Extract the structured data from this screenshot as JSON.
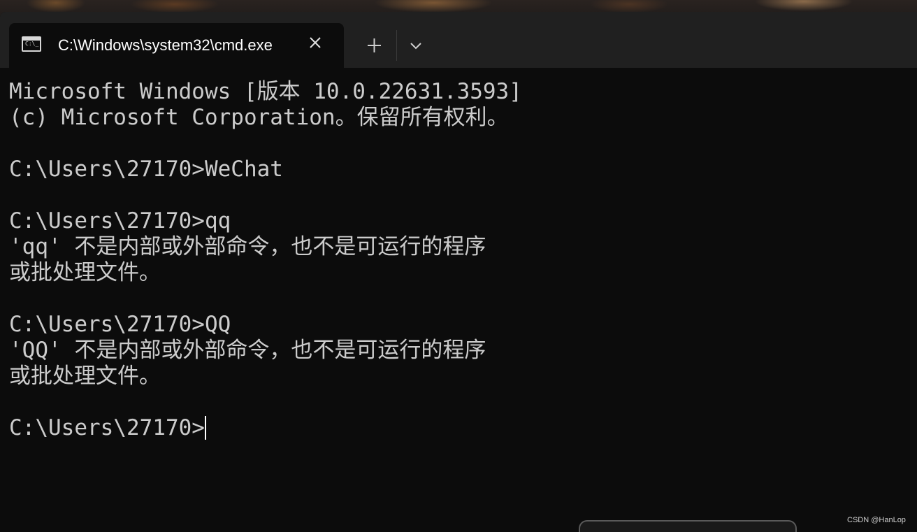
{
  "window": {
    "tab_title": "C:\\Windows\\system32\\cmd.exe",
    "tab_icon": "cmd-icon",
    "close_icon": "close-icon",
    "new_tab_icon": "plus-icon",
    "dropdown_icon": "chevron-down-icon"
  },
  "console": {
    "lines": [
      "Microsoft Windows [版本 10.0.22631.3593]",
      "(c) Microsoft Corporation。保留所有权利。",
      "",
      "C:\\Users\\27170>WeChat",
      "",
      "C:\\Users\\27170>qq",
      "'qq' 不是内部或外部命令，也不是可运行的程序",
      "或批处理文件。",
      "",
      "C:\\Users\\27170>QQ",
      "'QQ' 不是内部或外部命令，也不是可运行的程序",
      "或批处理文件。",
      "",
      "C:\\Users\\27170>"
    ]
  },
  "watermark": "CSDN @HanLop"
}
